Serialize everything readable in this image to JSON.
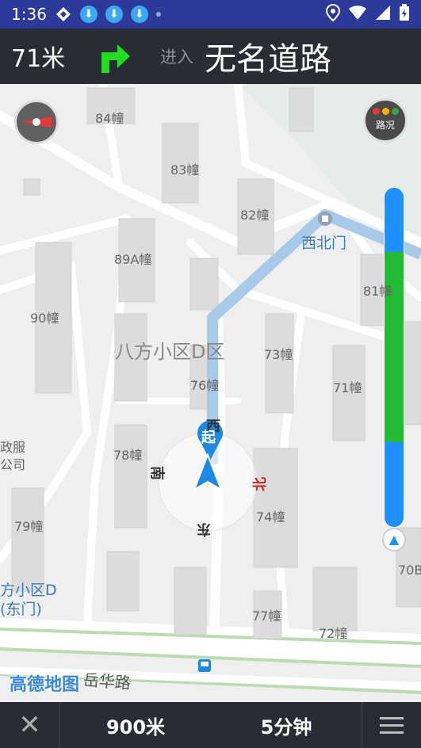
{
  "status": {
    "time": "1:36"
  },
  "nav": {
    "distance": "71米",
    "enter_label": "进入",
    "road_name": "无名道路"
  },
  "map": {
    "traffic_label": "路况",
    "start_marker": "起",
    "labels": {
      "b84": "84幢",
      "b83": "83幢",
      "b82": "82幢",
      "b89a": "89A幢",
      "b90": "90幢",
      "b81": "81幢",
      "xibeimen": "西北门",
      "area": "八方小区D区",
      "b73": "73幢",
      "b76": "76幢",
      "b71": "71幢",
      "b78": "78幢",
      "b74": "74幢",
      "b79": "79幢",
      "b77": "77幢",
      "b72": "72幢",
      "b70": "70B",
      "zhengfu": "政服",
      "gongsi": "公司",
      "east_gate_1": "方小区D",
      "east_gate_2": "(东门)",
      "road": "岳华路",
      "dir_west": "西",
      "dir_south": "南",
      "dir_north": "北",
      "dir_east": "东"
    },
    "logo": "高德地图",
    "progress": {
      "blue_top": 0.19,
      "green": 0.56,
      "blue_bottom": 0.25
    }
  },
  "bottom": {
    "close": "✕",
    "remaining_distance": "900米",
    "remaining_time": "5分钟"
  },
  "colors": {
    "header_bg": "#282c34",
    "status_bg": "#2d3a9a",
    "turn_arrow": "#22dd22",
    "route": "#a9c9e8",
    "progress_blue": "#1e90ff",
    "progress_green": "#22bb33"
  }
}
